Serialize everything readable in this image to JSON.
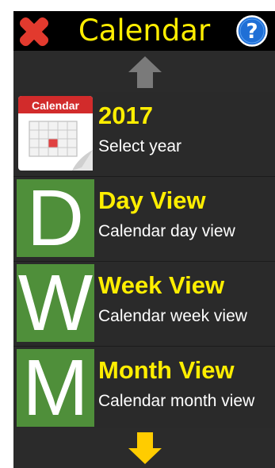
{
  "header": {
    "title": "Calendar",
    "close_icon": "close-x-icon",
    "help_icon": "help-question-icon",
    "help_symbol": "?"
  },
  "scroll": {
    "up_icon": "arrow-up-icon",
    "down_icon": "arrow-down-icon"
  },
  "menu": {
    "items": [
      {
        "icon": "calendar-icon",
        "icon_label": "Calendar",
        "title": "2017",
        "subtitle": "Select year"
      },
      {
        "icon": "letter-d-icon",
        "letter": "D",
        "title": "Day View",
        "subtitle": "Calendar day view"
      },
      {
        "icon": "letter-w-icon",
        "letter": "W",
        "title": "Week View",
        "subtitle": "Calendar week view"
      },
      {
        "icon": "letter-m-icon",
        "letter": "M",
        "title": "Month View",
        "subtitle": "Calendar month view"
      }
    ]
  },
  "colors": {
    "header_bg": "#000000",
    "title_yellow": "#ffee00",
    "close_red": "#e23a2e",
    "help_blue": "#1f6fd6",
    "tile_green": "#4f8f3a",
    "arrow_up_gray": "#7a7a7a",
    "arrow_down_yellow": "#ffcc00",
    "row_bg": "#2a2a2a"
  }
}
